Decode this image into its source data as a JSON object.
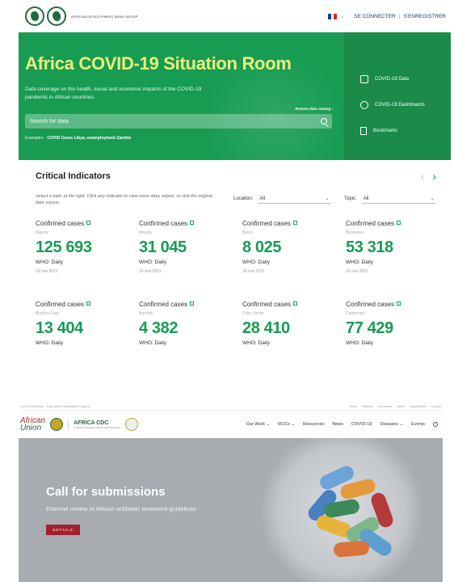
{
  "afdb": {
    "logo_text": "AFRICAN DEVELOPMENT BANK GROUP",
    "language_code": "FR",
    "login_label": "SE CONNECTER",
    "register_label": "S'ENREGISTRER",
    "separator": "|",
    "hero": {
      "title": "Africa COVID-19 Situation Room",
      "subtitle": "Data coverage on the health, social and economic impacts of the COVID-19 pandemic in African countries.",
      "browse_label": "Browse data catalog ›",
      "search_placeholder": "Search for data",
      "examples_label": "Examples:",
      "examples_value": "COVID Cases Libya, unemployment Zambia"
    },
    "side_links": [
      {
        "label": "COVID-19 Data",
        "icon": "database-icon"
      },
      {
        "label": "COVID-19 Dashboards",
        "icon": "dashboard-icon"
      },
      {
        "label": "Bookmarks",
        "icon": "bookmark-icon"
      }
    ],
    "indicators": {
      "title": "Critical Indicators",
      "note": "Select a topic at the right. Click any indicator to view more data, export, or visit the original data source.",
      "location_label": "Location:",
      "location_value": "All",
      "topic_label": "Topic:",
      "topic_value": "All",
      "items": [
        {
          "label": "Confirmed cases",
          "country": "Algeria",
          "value": "125 693",
          "source": "WHO: Daily",
          "date": "19 mai 2021"
        },
        {
          "label": "Confirmed cases",
          "country": "Angola",
          "value": "31 045",
          "source": "WHO: Daily",
          "date": "19 mai 2021"
        },
        {
          "label": "Confirmed cases",
          "country": "Benin",
          "value": "8 025",
          "source": "WHO: Daily",
          "date": "19 mai 2021"
        },
        {
          "label": "Confirmed cases",
          "country": "Botswana",
          "value": "53 318",
          "source": "WHO: Daily",
          "date": "19 mai 2021"
        },
        {
          "label": "Confirmed cases",
          "country": "Burkina Faso",
          "value": "13 404",
          "source": "WHO: Daily",
          "date": ""
        },
        {
          "label": "Confirmed cases",
          "country": "Burundi",
          "value": "4 382",
          "source": "WHO: Daily",
          "date": ""
        },
        {
          "label": "Confirmed cases",
          "country": "Cabo Verde",
          "value": "28 410",
          "source": "WHO: Daily",
          "date": ""
        },
        {
          "label": "Confirmed cases",
          "country": "Cameroon",
          "value": "77 429",
          "source": "WHO: Daily",
          "date": ""
        }
      ]
    }
  },
  "cdc": {
    "strip_text": "COVID-19 Vaccine - Track African Vaccination Progress",
    "strip_links": [
      "Home",
      "Features",
      "Documents",
      "Media",
      "Opportunities",
      "Contact"
    ],
    "au_text_1": "African",
    "au_text_2": "Union",
    "cdc_name": "AFRICA CDC",
    "cdc_tagline": "Centres for Disease Control and Prevention",
    "menu": [
      "Our Work ⌄",
      "RCCs ⌄",
      "Resources",
      "News",
      "COVID-19",
      "Diseases ⌄",
      "Events"
    ],
    "banner": {
      "title": "Call for submissions",
      "subtitle": "External review of African antibiotic treatment guidelines",
      "button": "DETAILS"
    }
  },
  "colors": {
    "afdb_green": "#179c52",
    "title_yellow": "#e9f07e",
    "cdc_red": "#a51f2e"
  }
}
